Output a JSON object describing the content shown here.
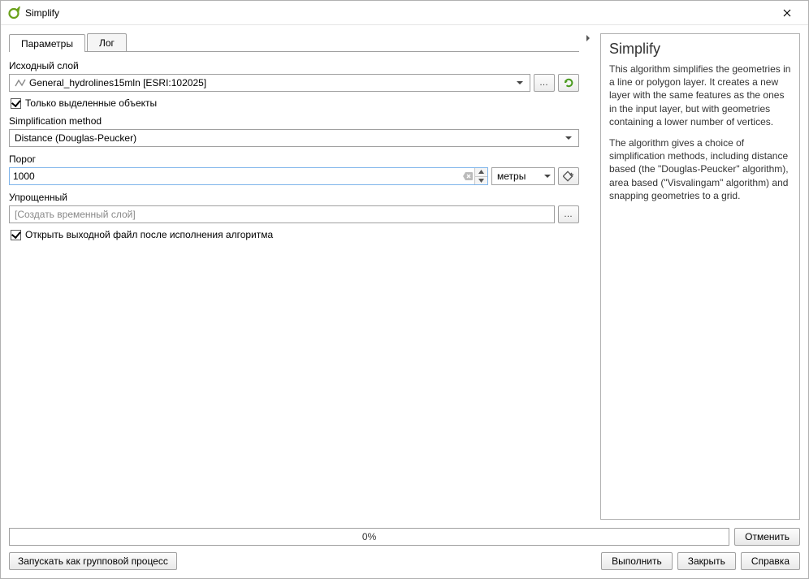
{
  "window": {
    "title": "Simplify"
  },
  "tabs": {
    "params": "Параметры",
    "log": "Лог"
  },
  "inputLayer": {
    "label": "Исходный слой",
    "value": "General_hydrolines15mln [ESRI:102025]",
    "selectedOnly": "Только выделенные объекты"
  },
  "method": {
    "label": "Simplification method",
    "value": "Distance (Douglas-Peucker)"
  },
  "threshold": {
    "label": "Порог",
    "value": "1000",
    "unit": "метры"
  },
  "output": {
    "label": "Упрощенный",
    "placeholder": "[Создать временный слой]",
    "openAfter": "Открыть выходной файл после исполнения алгоритма"
  },
  "help": {
    "title": "Simplify",
    "p1": "This algorithm simplifies the geometries in a line or polygon layer. It creates a new layer with the same features as the ones in the input layer, but with geometries containing a lower number of vertices.",
    "p2": "The algorithm gives a choice of simplification methods, including distance based (the \"Douglas-Peucker\" algorithm), area based (\"Visvalingam\" algorithm) and snapping geometries to a grid."
  },
  "progress": {
    "text": "0%"
  },
  "buttons": {
    "cancel": "Отменить",
    "batch": "Запускать как групповой процесс",
    "run": "Выполнить",
    "close": "Закрыть",
    "help_btn": "Справка"
  }
}
